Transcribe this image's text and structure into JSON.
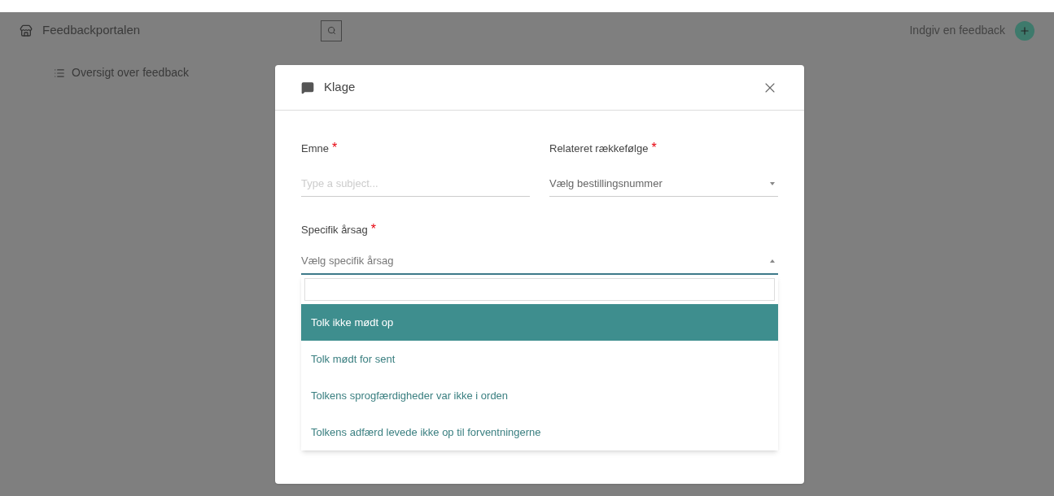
{
  "header": {
    "brand": "Feedbackportalen",
    "action": "Indgiv en feedback"
  },
  "sidebar": {
    "items": [
      {
        "label": "Oversigt over feedback"
      }
    ]
  },
  "modal": {
    "title": "Klage",
    "fields": [
      {
        "label": "Emne",
        "required_mark": "*",
        "kind": "text",
        "placeholder": "Type a subject..."
      },
      {
        "label": "Relateret rækkefølge",
        "required_mark": "*",
        "kind": "select",
        "placeholder": "Vælg bestillingsnummer"
      }
    ],
    "reason": {
      "label": "Specifik årsag",
      "required_mark": "*",
      "placeholder": "Vælg specifik årsag",
      "expanded": true,
      "options": [
        {
          "label": "Tolk ikke mødt op",
          "selected": true
        },
        {
          "label": "Tolk mødt for sent",
          "selected": false
        },
        {
          "label": "Tolkens sprogfærdigheder var ikke i orden",
          "selected": false
        },
        {
          "label": "Tolkens adfærd levede ikke op til forventningerne",
          "selected": false
        }
      ]
    }
  }
}
